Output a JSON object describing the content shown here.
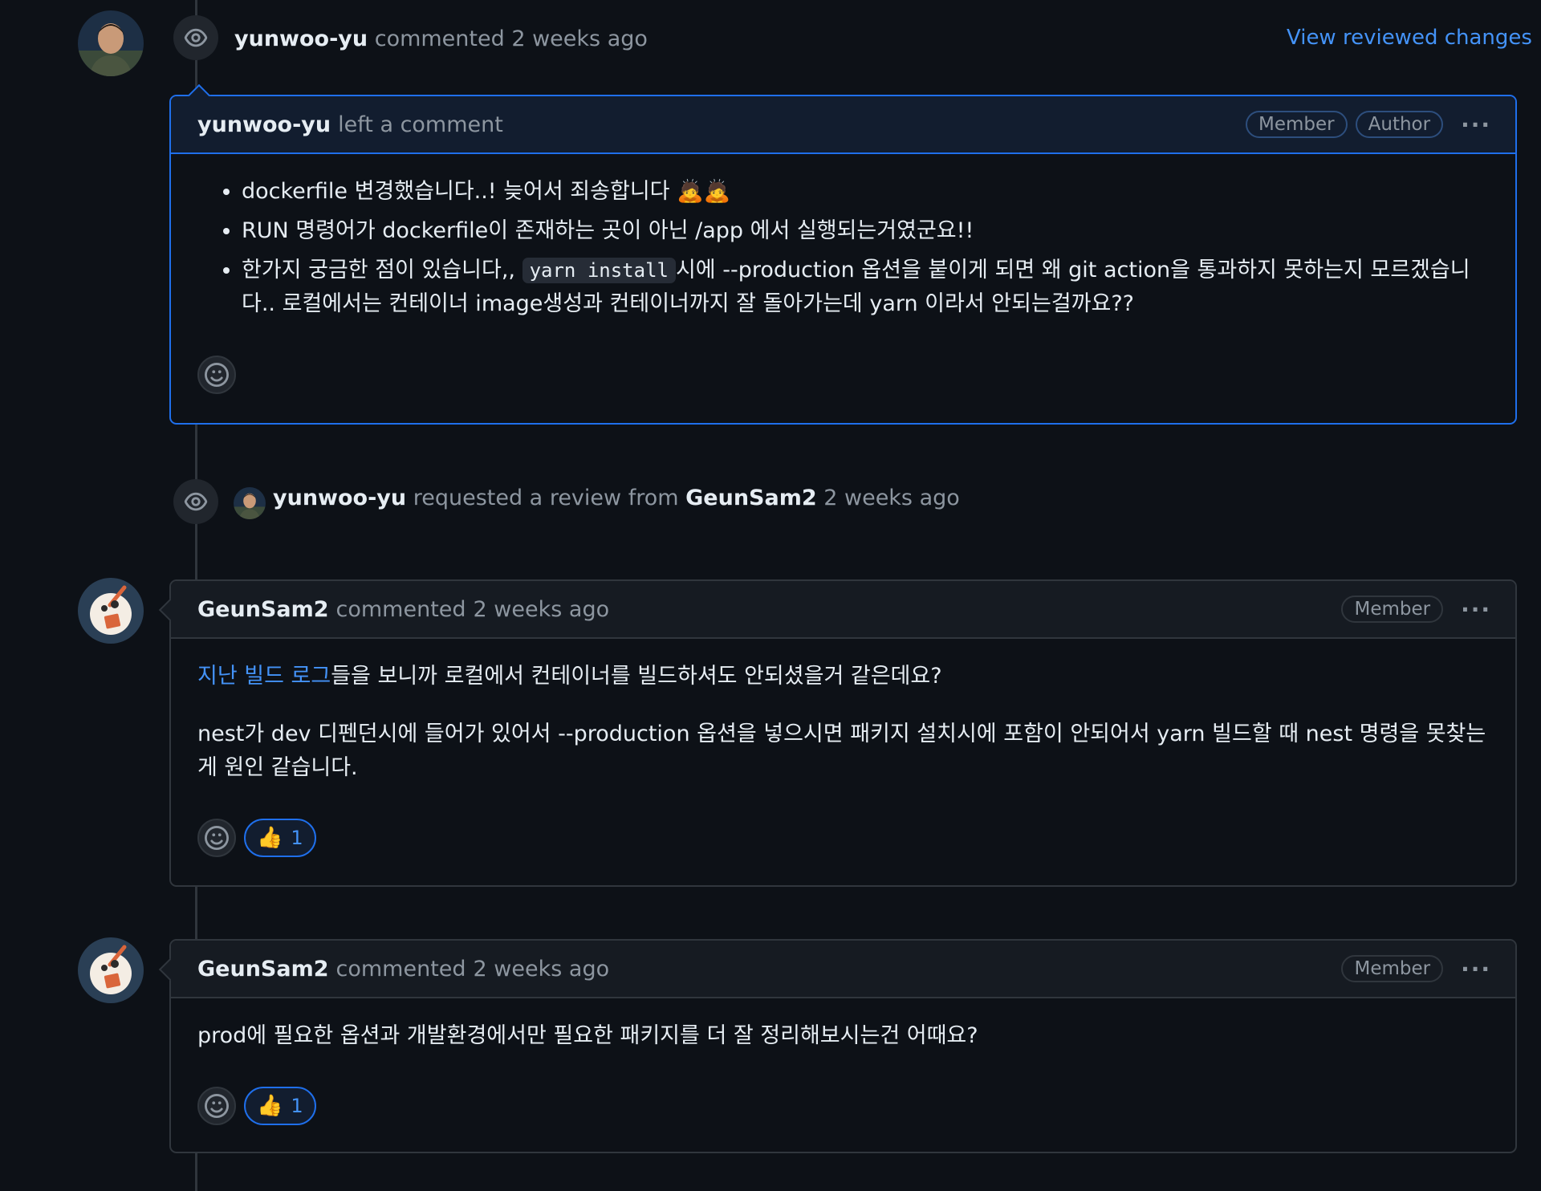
{
  "event1": {
    "author": "yunwoo-yu",
    "action": "commented",
    "time": "2 weeks ago",
    "view_link": "View reviewed changes"
  },
  "comment1": {
    "author": "yunwoo-yu",
    "action": "left a comment",
    "labels": [
      "Member",
      "Author"
    ],
    "bullets": [
      "dockerfile 변경했습니다..! 늦어서 죄송합니다 🙇🙇",
      "RUN 명령어가 dockerfile이 존재하는 곳이 아닌 /app 에서 실행되는거였군요!!"
    ],
    "bullet3_before": "한가지 궁금한 점이 있습니다,, ",
    "bullet3_code": "yarn install",
    "bullet3_after": "시에 --production 옵션을 붙이게 되면 왜 git action을 통과하지 못하는지 모르겠습니다.. 로컬에서는 컨테이너 image생성과 컨테이너까지 잘 돌아가는데 yarn 이라서 안되는걸까요??"
  },
  "review_request": {
    "author": "yunwoo-yu",
    "action": "requested a review from",
    "reviewer": "GeunSam2",
    "time": "2 weeks ago"
  },
  "comment2": {
    "author": "GeunSam2",
    "action": "commented",
    "time": "2 weeks ago",
    "label": "Member",
    "link_text": "지난 빌드 로그",
    "para1_rest": "들을 보니까 로컬에서 컨테이너를 빌드하셔도 안되셨을거 같은데요?",
    "para2": "nest가 dev 디펜던시에 들어가 있어서 --production 옵션을 넣으시면 패키지 설치시에 포함이 안되어서 yarn 빌드할 때 nest 명령을 못찾는게 원인 같습니다.",
    "thumbs_count": "1"
  },
  "comment3": {
    "author": "GeunSam2",
    "action": "commented",
    "time": "2 weeks ago",
    "label": "Member",
    "text": "prod에 필요한 옵션과 개발환경에서만 필요한 패키지를 더 잘 정리해보시는건 어때요?",
    "thumbs_count": "1"
  },
  "icons": {
    "eye": "eye-icon",
    "smiley": "smiley-icon",
    "thumbs_up": "thumbs-up-emoji",
    "kebab": "kebab-horizontal-icon"
  },
  "colors": {
    "background": "#0d1117",
    "link": "#4493f8",
    "author_border": "#1f6feb",
    "muted": "#8d96a0"
  }
}
